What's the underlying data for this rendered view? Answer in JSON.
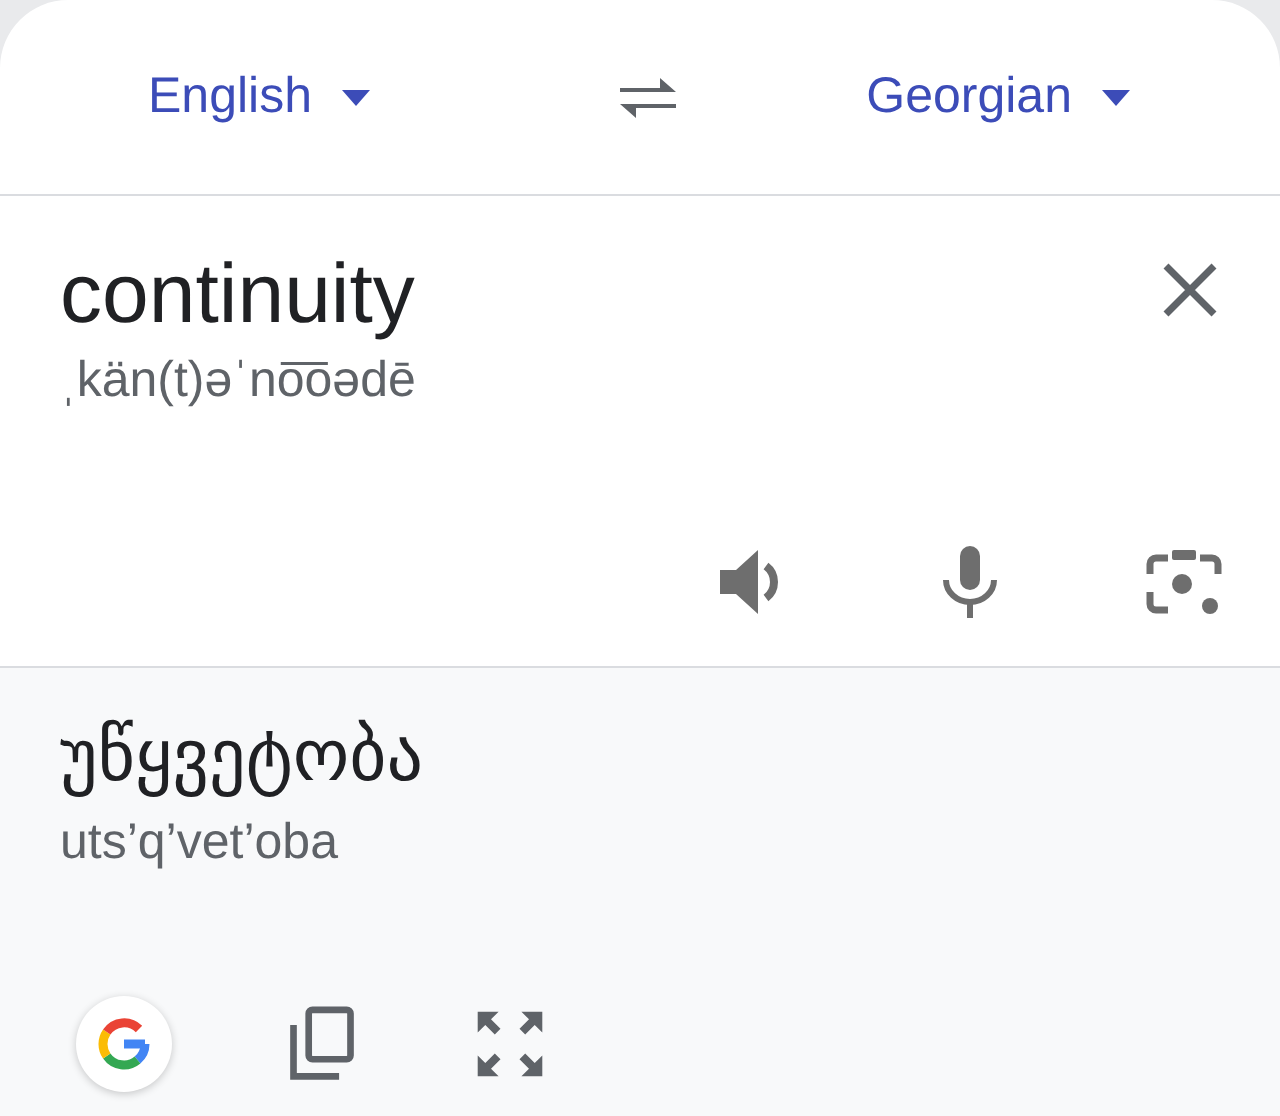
{
  "languages": {
    "source": {
      "label": "English"
    },
    "target": {
      "label": "Georgian"
    }
  },
  "input": {
    "text": "continuity",
    "pronunciation": "ˌkän(t)əˈno͞oədē"
  },
  "output": {
    "text": "უწყვეტობა",
    "transliteration": "uts’q’vet’oba"
  }
}
